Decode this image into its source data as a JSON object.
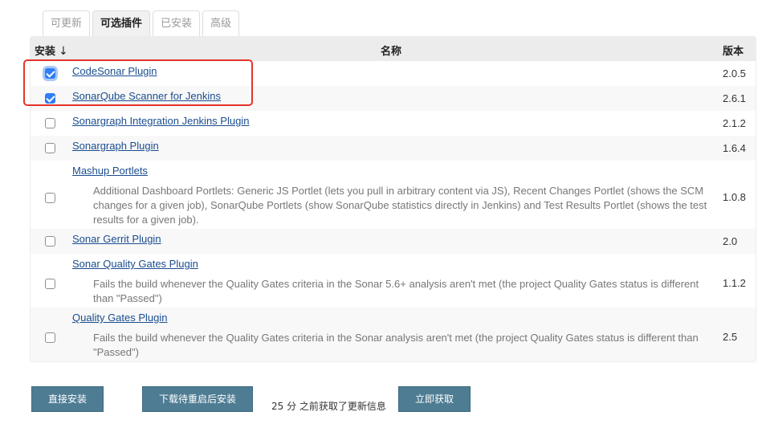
{
  "tabs": [
    {
      "label": "可更新",
      "active": false
    },
    {
      "label": "可选插件",
      "active": true
    },
    {
      "label": "已安装",
      "active": false
    },
    {
      "label": "高级",
      "active": false
    }
  ],
  "table": {
    "headers": {
      "install": "安装",
      "sort_icon": "↓",
      "name": "名称",
      "version": "版本"
    },
    "rows": [
      {
        "name": "CodeSonar Plugin",
        "description": "",
        "version": "2.0.5",
        "checked": true
      },
      {
        "name": "SonarQube Scanner for Jenkins",
        "description": "",
        "version": "2.6.1",
        "checked": true
      },
      {
        "name": "Sonargraph Integration Jenkins Plugin",
        "description": "",
        "version": "2.1.2",
        "checked": false
      },
      {
        "name": "Sonargraph Plugin",
        "description": "",
        "version": "1.6.4",
        "checked": false
      },
      {
        "name": "Mashup Portlets",
        "description": "Additional Dashboard Portlets: Generic JS Portlet (lets you pull in arbitrary content via JS), Recent Changes Portlet (shows the SCM changes for a given job), SonarQube Portlets (show SonarQube statistics directly in Jenkins) and Test Results Portlet (shows the test results for a given job).",
        "version": "1.0.8",
        "checked": false
      },
      {
        "name": "Sonar Gerrit Plugin",
        "description": "",
        "version": "2.0",
        "checked": false
      },
      {
        "name": "Sonar Quality Gates Plugin",
        "description": "Fails the build whenever the Quality Gates criteria in the Sonar 5.6+ analysis aren't met (the project Quality Gates status is different than \"Passed\")",
        "version": "1.1.2",
        "checked": false
      },
      {
        "name": "Quality Gates Plugin",
        "description": "Fails the build whenever the Quality Gates criteria in the Sonar analysis aren't met (the project Quality Gates status is different than \"Passed\")",
        "version": "2.5",
        "checked": false
      }
    ]
  },
  "footer": {
    "install_now": "直接安装",
    "download_restart": "下载待重启后安装",
    "update_info": "25 分 之前获取了更新信息",
    "fetch_now": "立即获取"
  },
  "colors": {
    "highlight_box": "#e5332a",
    "button_bg": "#4e7c93",
    "link": "#1a4d8f",
    "checkbox_checked": "#2f7ef6"
  }
}
